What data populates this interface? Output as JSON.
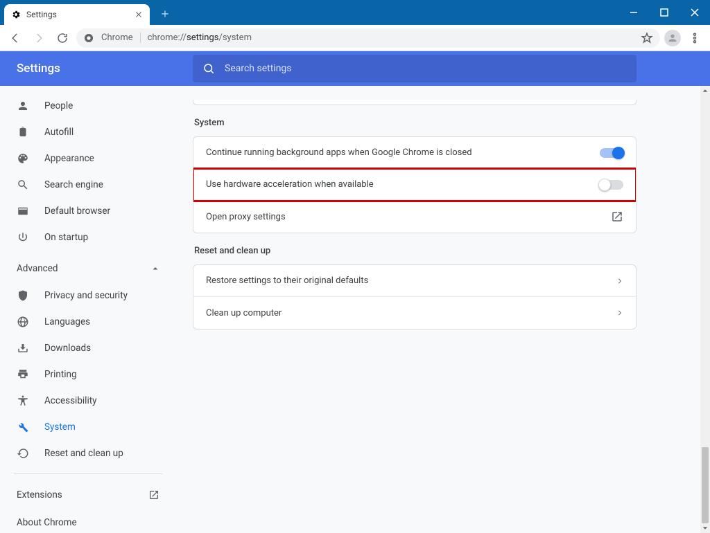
{
  "window": {
    "tab_title": "Settings"
  },
  "toolbar": {
    "chip": "Chrome",
    "url_prefix": "chrome://",
    "url_bold": "settings",
    "url_suffix": "/system"
  },
  "header": {
    "title": "Settings",
    "search_placeholder": "Search settings"
  },
  "sidebar": {
    "basic": [
      {
        "icon": "person",
        "label": "People"
      },
      {
        "icon": "clipboard",
        "label": "Autofill"
      },
      {
        "icon": "palette",
        "label": "Appearance"
      },
      {
        "icon": "search",
        "label": "Search engine"
      },
      {
        "icon": "browser",
        "label": "Default browser"
      },
      {
        "icon": "power",
        "label": "On startup"
      }
    ],
    "advanced_label": "Advanced",
    "advanced": [
      {
        "icon": "shield",
        "label": "Privacy and security"
      },
      {
        "icon": "globe",
        "label": "Languages"
      },
      {
        "icon": "download",
        "label": "Downloads"
      },
      {
        "icon": "print",
        "label": "Printing"
      },
      {
        "icon": "a11y",
        "label": "Accessibility"
      },
      {
        "icon": "wrench",
        "label": "System",
        "active": true
      },
      {
        "icon": "restore",
        "label": "Reset and clean up"
      }
    ],
    "extensions": "Extensions",
    "about": "About Chrome"
  },
  "content": {
    "system_title": "System",
    "system_rows": [
      {
        "label": "Continue running background apps when Google Chrome is closed",
        "toggle": true
      },
      {
        "label": "Use hardware acceleration when available",
        "toggle": false,
        "highlight": true
      },
      {
        "label": "Open proxy settings",
        "launch": true
      }
    ],
    "reset_title": "Reset and clean up",
    "reset_rows": [
      {
        "label": "Restore settings to their original defaults"
      },
      {
        "label": "Clean up computer"
      }
    ]
  }
}
